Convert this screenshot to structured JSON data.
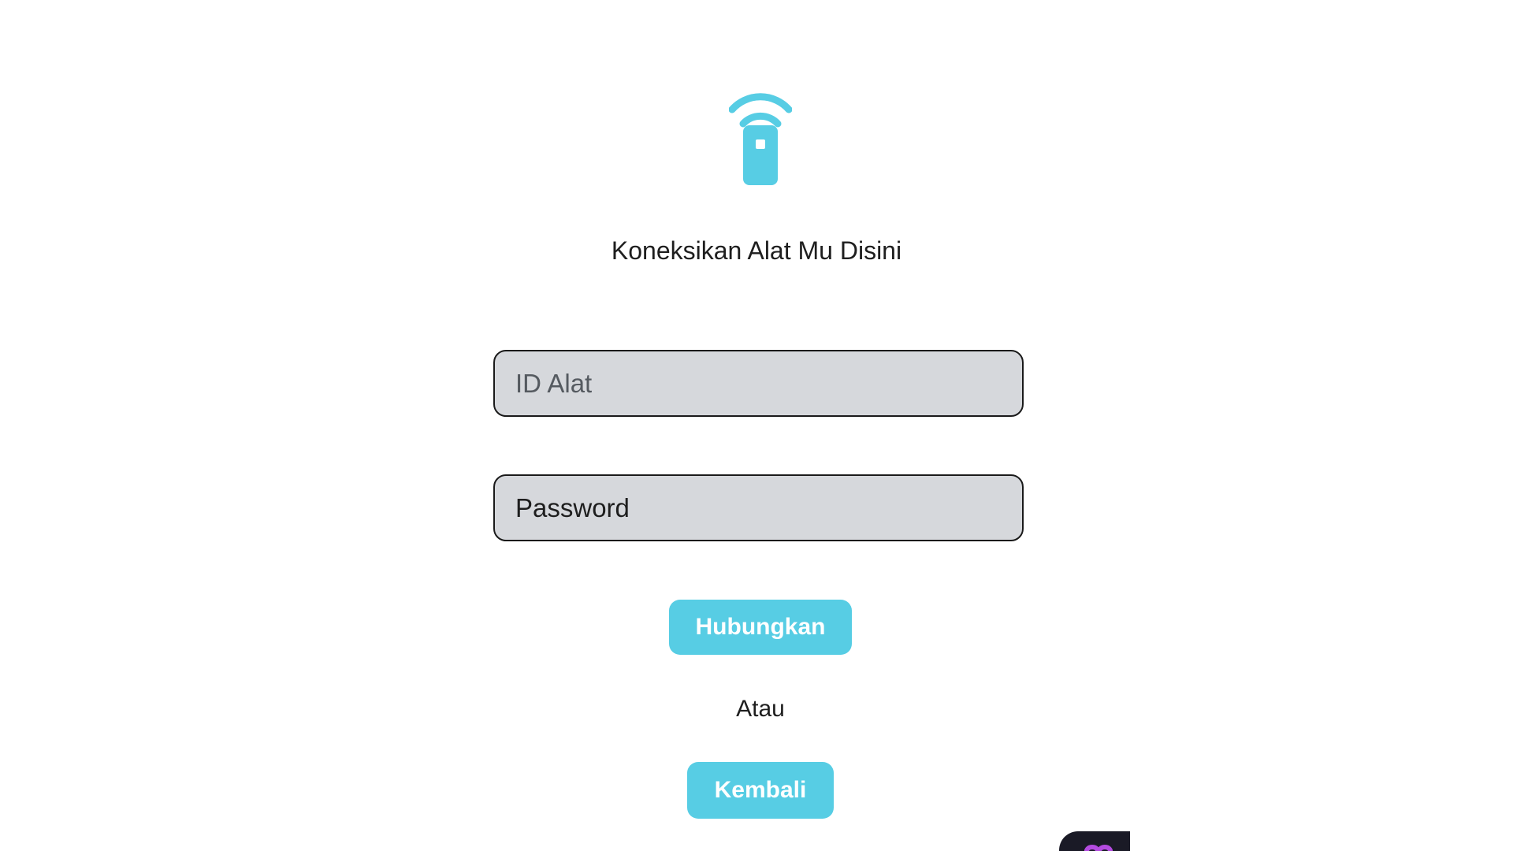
{
  "header": {
    "logo_icon": "remote-wifi-icon",
    "title": "Koneksikan Alat Mu Disini"
  },
  "form": {
    "device_id_placeholder": "ID Alat",
    "password_placeholder": "Password",
    "connect_label": "Hubungkan",
    "or_label": "Atau",
    "back_label": "Kembali"
  },
  "colors": {
    "accent": "#57cde4",
    "field_bg": "#d6d8dc",
    "field_border": "#1a1a1a",
    "text": "#1e1e1e"
  },
  "floating_widget": {
    "icon": "app-badge-icon"
  }
}
